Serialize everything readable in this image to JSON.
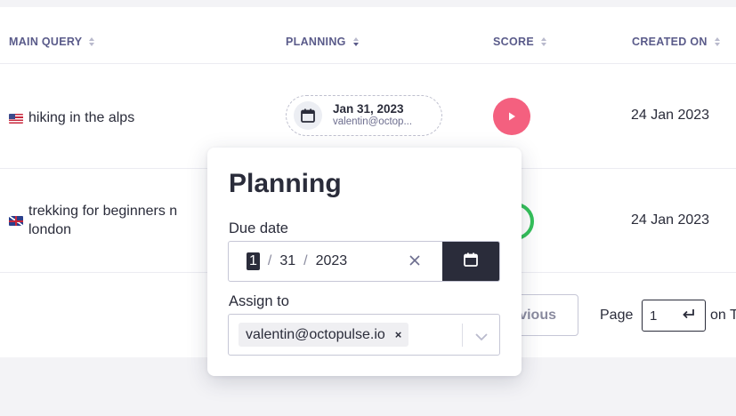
{
  "table": {
    "headers": [
      {
        "label": "MAIN QUERY"
      },
      {
        "label": "PLANNING"
      },
      {
        "label": "SCORE"
      },
      {
        "label": "CREATED ON"
      }
    ],
    "rows": [
      {
        "flag": "us-flag-icon",
        "query": "hiking in the alps",
        "planning_date": "Jan 31, 2023",
        "planning_user": "valentin@octop...",
        "score_icon": "play-icon",
        "created_on": "24 Jan 2023"
      },
      {
        "flag": "uk-flag-icon",
        "query_line1": "trekking for beginners n",
        "query_line2": "london",
        "score_icon": "score-ring-icon",
        "created_on": "24 Jan 2023"
      }
    ]
  },
  "pagination": {
    "previous_label": "vious",
    "page_label": "Page",
    "page_value": "1",
    "on_label": "on T"
  },
  "popover": {
    "title": "Planning",
    "due_date_label": "Due date",
    "date": {
      "month": "1",
      "day": "31",
      "year": "2023",
      "sep": "/"
    },
    "assign_label": "Assign to",
    "assignee": "valentin@octopulse.io",
    "chip_remove": "×"
  },
  "colors": {
    "accent_dark": "#2a2c3a",
    "header_text": "#5a5b8a",
    "score_pink": "#f4607f",
    "score_green": "#34c15a"
  }
}
